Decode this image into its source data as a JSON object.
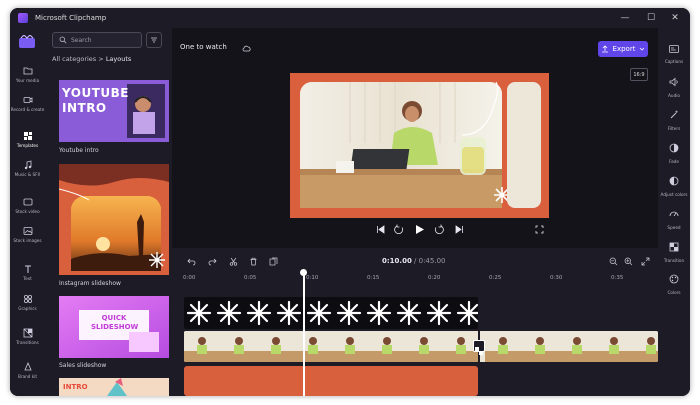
{
  "app": {
    "title": "Microsoft Clipchamp"
  },
  "window_controls": {
    "minimize": "—",
    "maximize": "☐",
    "close": "✕"
  },
  "left_rail": {
    "items": [
      {
        "label": "Your media",
        "icon": "folder-icon"
      },
      {
        "label": "Record & create",
        "icon": "camera-icon"
      },
      {
        "label": "Templates",
        "icon": "templates-icon"
      },
      {
        "label": "Music & SFX",
        "icon": "music-icon"
      },
      {
        "label": "Stock video",
        "icon": "film-icon"
      },
      {
        "label": "Stock images",
        "icon": "image-icon"
      },
      {
        "label": "Text",
        "icon": "text-icon"
      },
      {
        "label": "Graphics",
        "icon": "shapes-icon"
      },
      {
        "label": "Transitions",
        "icon": "transitions-icon"
      },
      {
        "label": "Brand kit",
        "icon": "brand-icon"
      }
    ]
  },
  "panel": {
    "search_placeholder": "Search",
    "breadcrumb": {
      "parent": "All categories",
      "separator": ">",
      "current": "Layouts"
    },
    "templates": [
      {
        "title": "Youtube intro",
        "thumb_text": "YOUTUBE INTRO"
      },
      {
        "title": "Instagram slideshow",
        "thumb_text": ""
      },
      {
        "title": "Sales slideshow",
        "thumb_text": "QUICK SLIDESHOW"
      },
      {
        "title": "",
        "thumb_text": "INTRO"
      }
    ]
  },
  "editor": {
    "project_name": "One to watch",
    "export_label": "Export",
    "aspect_ratio": "16:9"
  },
  "right_rail": {
    "items": [
      {
        "label": "Captions",
        "icon": "captions-icon"
      },
      {
        "label": "Audio",
        "icon": "speaker-icon"
      },
      {
        "label": "Filters",
        "icon": "magic-icon"
      },
      {
        "label": "Fade",
        "icon": "fade-icon"
      },
      {
        "label": "Adjust colors",
        "icon": "contrast-icon"
      },
      {
        "label": "Speed",
        "icon": "speedometer-icon"
      },
      {
        "label": "Transition",
        "icon": "transition-icon"
      },
      {
        "label": "Colors",
        "icon": "palette-icon"
      }
    ]
  },
  "timeline": {
    "current_time": "0:10.00",
    "separator": " / ",
    "total_time": "0:45.00",
    "ruler": [
      "0:00",
      "0:05",
      "0:10",
      "0:15",
      "0:20",
      "0:25",
      "0:30",
      "0:35"
    ]
  },
  "colors": {
    "accent": "#6045e8",
    "brand_orange": "#d95f3d",
    "background": "#1d1b26"
  }
}
